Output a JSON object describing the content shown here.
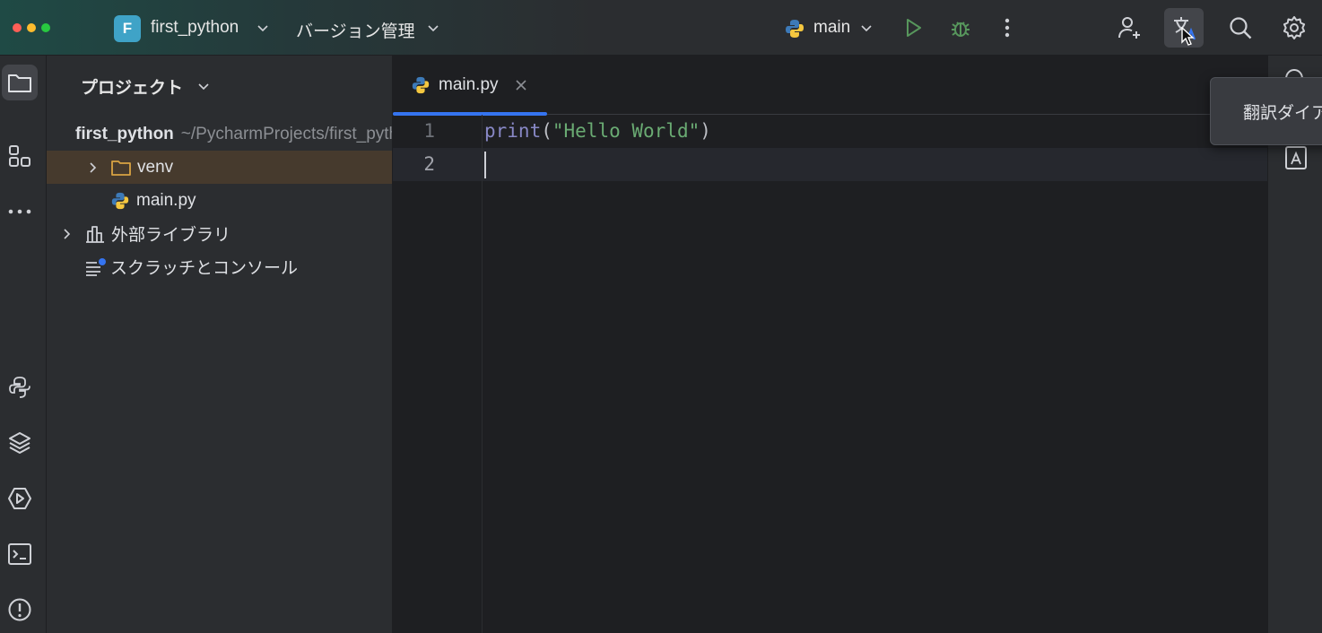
{
  "titlebar": {
    "project_initial": "F",
    "project_name": "first_python",
    "vcs_label": "バージョン管理",
    "run_config": "main",
    "icons": [
      "run-icon",
      "debug-icon",
      "more-icon",
      "add-user-icon",
      "translate-icon",
      "search-icon",
      "settings-icon"
    ]
  },
  "toolstrip": {
    "icons": [
      "folder-icon",
      "structure-icon",
      "more-tools-icon",
      "python-console-icon",
      "layers-icon",
      "services-icon",
      "terminal-icon",
      "problems-icon"
    ]
  },
  "project_panel": {
    "title": "プロジェクト",
    "tree": [
      {
        "label": "first_python",
        "sub": "~/PycharmProjects/first_python"
      },
      {
        "label": "venv"
      },
      {
        "label": "main.py"
      },
      {
        "label": "外部ライブラリ"
      },
      {
        "label": "スクラッチとコンソール"
      }
    ]
  },
  "editor": {
    "tab_label": "main.py",
    "line_numbers": [
      "1",
      "2"
    ],
    "code": {
      "fn": "print",
      "open": "(",
      "str": "\"Hello World\"",
      "close": ")"
    }
  },
  "tooltip": {
    "text": "翻訳ダイアログ"
  },
  "colors": {
    "accent": "#3574f0",
    "run": "#57965c",
    "folder": "#d9a343",
    "highlight": "#463a2d"
  }
}
